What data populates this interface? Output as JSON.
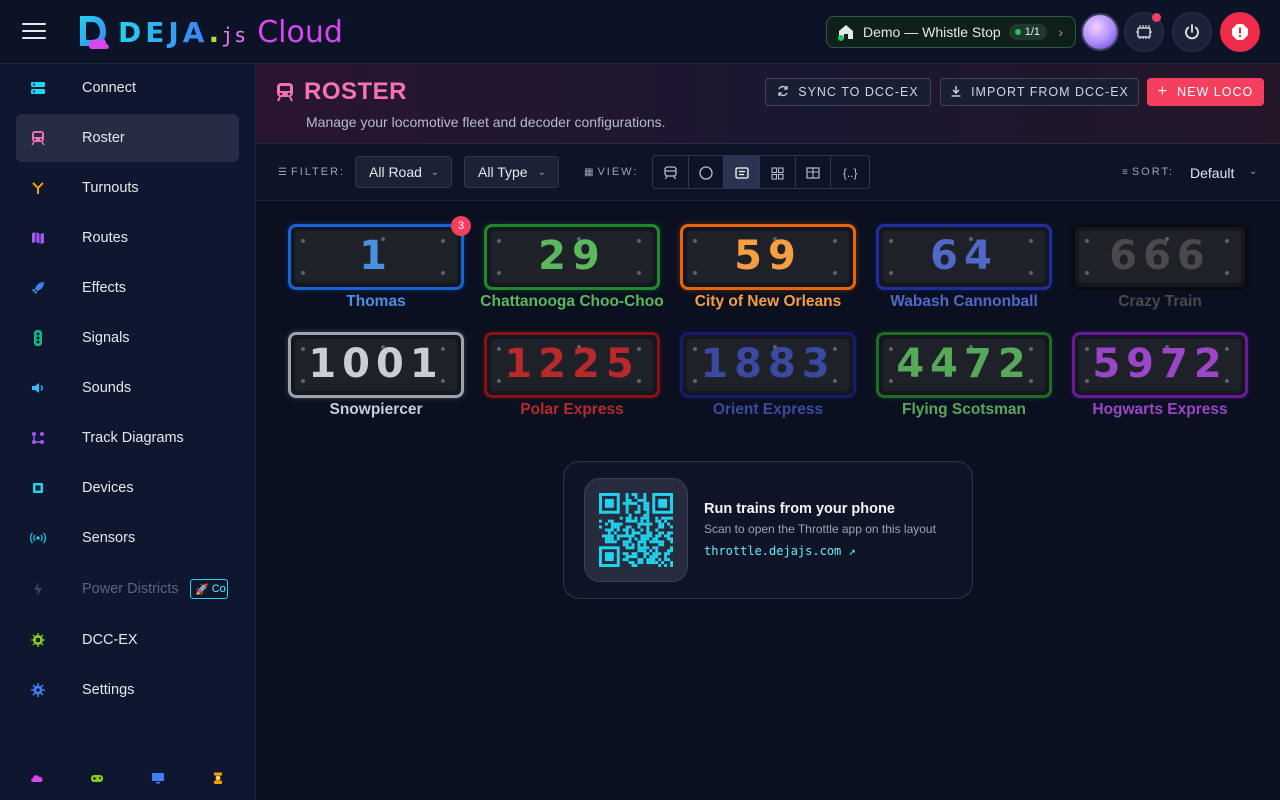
{
  "app": {
    "logo_main": "DEJA",
    "logo_dot": ".",
    "logo_js": "js",
    "logo_cloud": "Cloud"
  },
  "topbar": {
    "layout_name": "Demo — Whistle Stop",
    "layout_count": "1/1",
    "chevron": "›"
  },
  "sidebar": {
    "items": [
      {
        "label": "Connect",
        "icon": "connect-icon"
      },
      {
        "label": "Roster",
        "icon": "train-icon"
      },
      {
        "label": "Turnouts",
        "icon": "turnout-icon"
      },
      {
        "label": "Routes",
        "icon": "map-icon"
      },
      {
        "label": "Effects",
        "icon": "rocket-icon"
      },
      {
        "label": "Signals",
        "icon": "traffic-light-icon"
      },
      {
        "label": "Sounds",
        "icon": "speaker-icon"
      },
      {
        "label": "Track Diagrams",
        "icon": "diagram-icon"
      },
      {
        "label": "Devices",
        "icon": "chip-icon"
      },
      {
        "label": "Sensors",
        "icon": "sensor-icon"
      },
      {
        "label": "Power Districts",
        "icon": "bolt-icon"
      },
      {
        "label": "DCC-EX",
        "icon": "cog-chip-icon"
      },
      {
        "label": "Settings",
        "icon": "gear-icon"
      }
    ],
    "power_badge": "Co"
  },
  "header": {
    "title": "ROSTER",
    "subtitle": "Manage your locomotive fleet and decoder configurations.",
    "sync_label": "SYNC TO DCC-EX",
    "import_label": "IMPORT FROM DCC-EX",
    "new_label": "NEW LOCO"
  },
  "toolbar": {
    "filter_label": "FILTER:",
    "road_value": "All Road",
    "type_value": "All Type",
    "view_label": "VIEW:",
    "json_view": "{..}",
    "sort_label": "SORT:",
    "sort_value": "Default"
  },
  "locos": [
    {
      "number": "1",
      "name": "Thomas",
      "color": "#1565d8",
      "text": "#4a90e2",
      "badge": "3"
    },
    {
      "number": "29",
      "name": "Chattanooga Choo-Choo",
      "color": "#1f8a2c",
      "text": "#5cb85c"
    },
    {
      "number": "59",
      "name": "City of New Orleans",
      "color": "#e8650e",
      "text": "#f59e42"
    },
    {
      "number": "64",
      "name": "Wabash Cannonball",
      "color": "#1f2fa0",
      "text": "#5068c8"
    },
    {
      "number": "666",
      "name": "Crazy Train",
      "color": "#0b0b0b",
      "text": "#4a4a4a"
    },
    {
      "number": "1001",
      "name": "Snowpiercer",
      "color": "#9aa3ae",
      "text": "#c8ced6"
    },
    {
      "number": "1225",
      "name": "Polar Express",
      "color": "#8a1212",
      "text": "#b82a2a"
    },
    {
      "number": "1883",
      "name": "Orient Express",
      "color": "#141c70",
      "text": "#3a4aa0"
    },
    {
      "number": "4472",
      "name": "Flying Scotsman",
      "color": "#1e6e22",
      "text": "#57a858"
    },
    {
      "number": "5972",
      "name": "Hogwarts Express",
      "color": "#6a1a9a",
      "text": "#9b45c8"
    }
  ],
  "qr": {
    "title": "Run trains from your phone",
    "subtitle": "Scan to open the Throttle app on this layout",
    "link": "throttle.dejajs.com ↗"
  }
}
